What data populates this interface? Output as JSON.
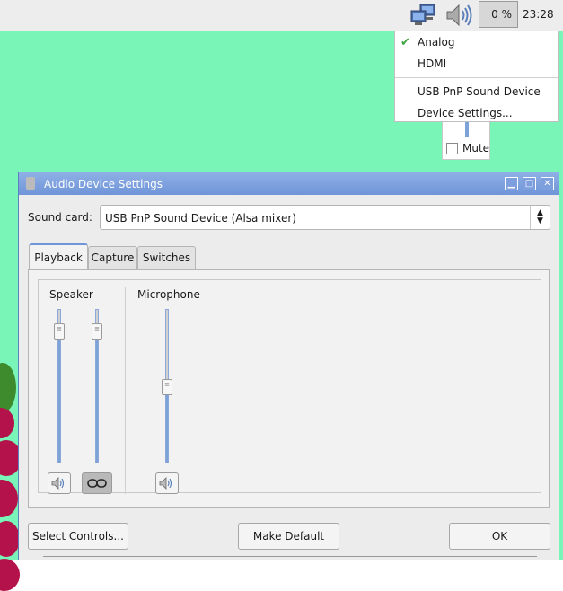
{
  "panel": {
    "cpu_value": "0 %",
    "clock": "23:28",
    "network_icon": "network-icon",
    "volume_icon": "speaker-icon"
  },
  "menu": {
    "items": [
      "Analog",
      "HDMI",
      "USB PnP Sound Device",
      "Device Settings..."
    ],
    "checked": "Analog"
  },
  "volume_popup": {
    "mute_label": "Mute"
  },
  "window": {
    "title": "Audio Device Settings",
    "sound_card_label": "Sound card:",
    "sound_card_value": "USB PnP Sound Device (Alsa mixer)",
    "tabs": [
      "Playback",
      "Capture",
      "Switches"
    ],
    "active_tab": "Playback",
    "groups": [
      {
        "label": "Speaker"
      },
      {
        "label": "Microphone"
      }
    ],
    "buttons": {
      "select_controls": "Select Controls...",
      "make_default": "Make Default",
      "ok": "OK"
    }
  },
  "colors": {
    "desktop": "#79f5b7",
    "titlebar": "#6f95d8",
    "slider_fill": "#7da2d8",
    "check": "#3ea43e"
  }
}
